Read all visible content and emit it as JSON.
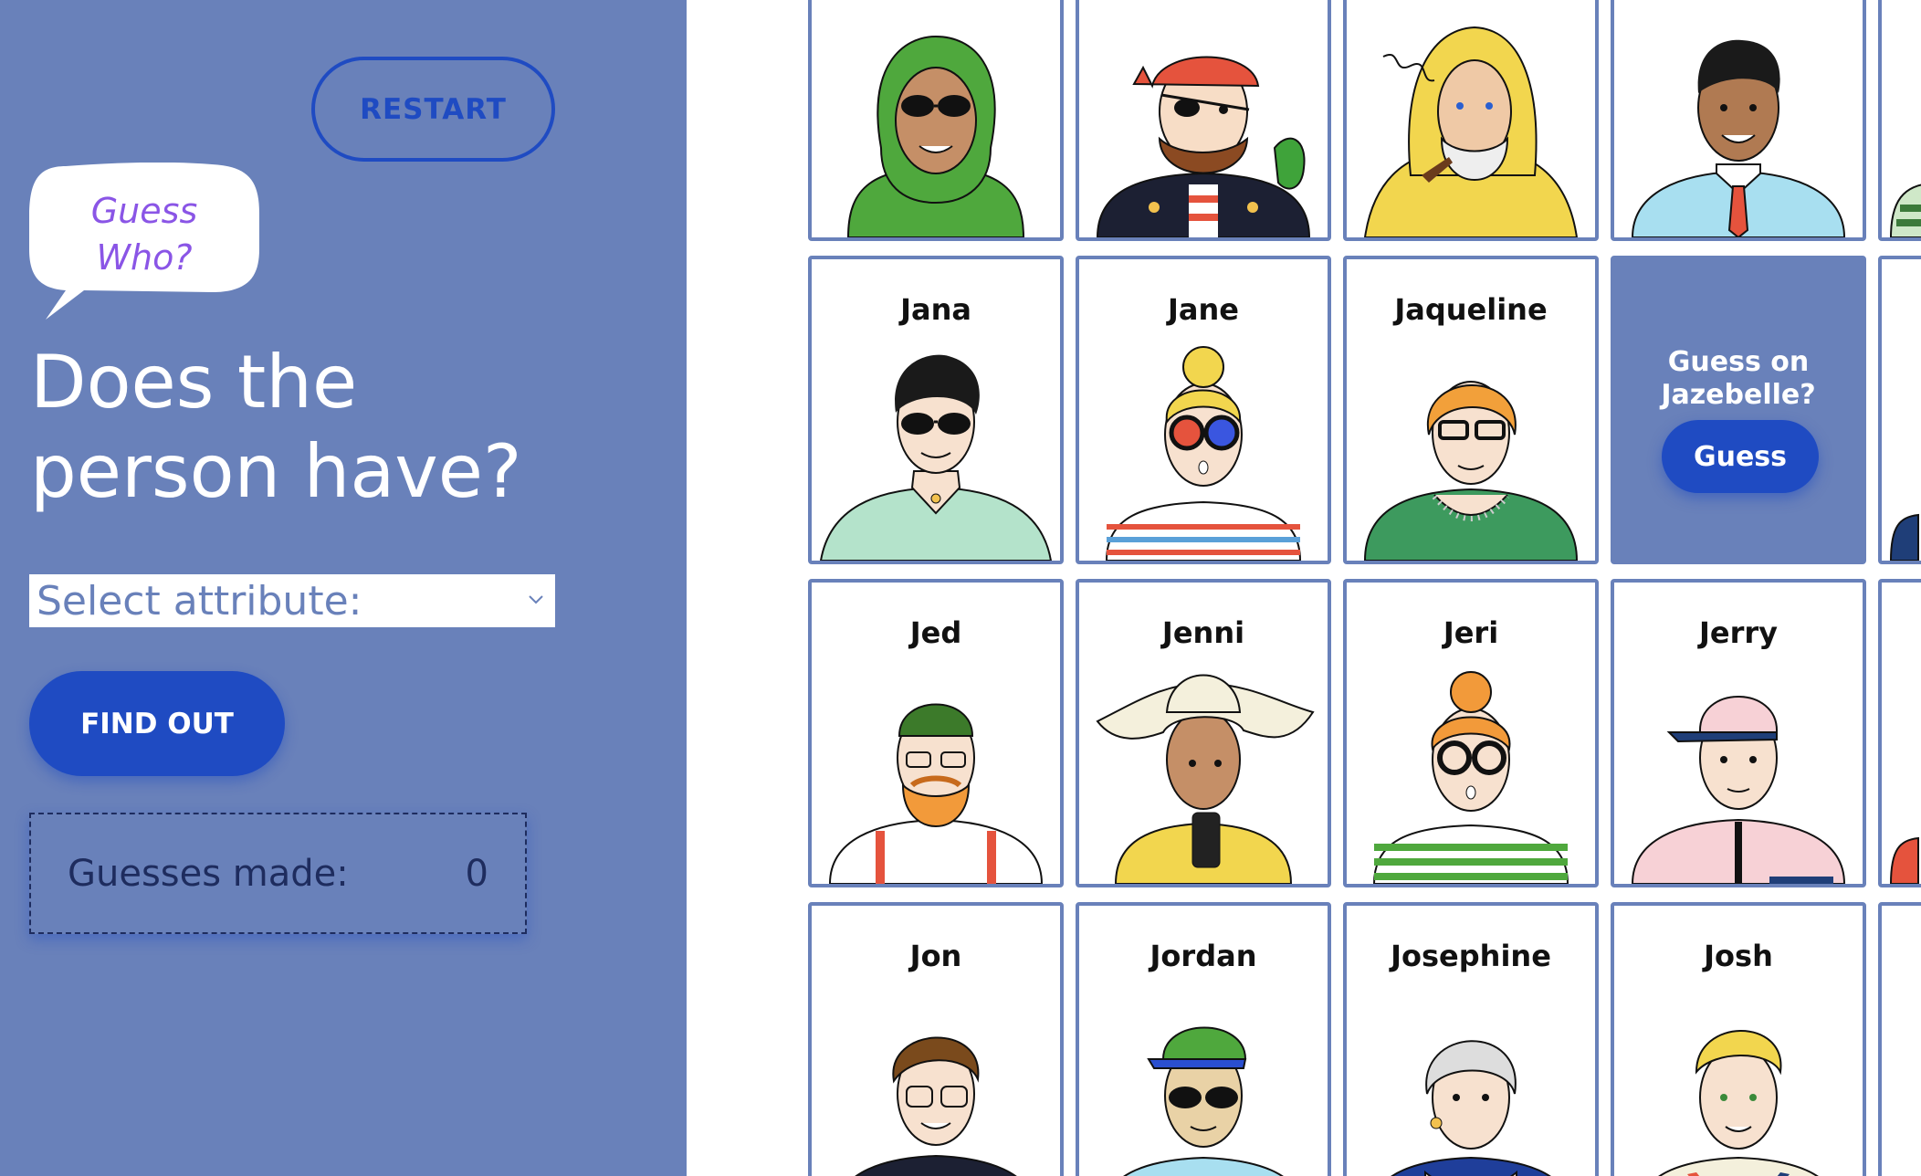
{
  "sidebar": {
    "restart_label": "RESTART",
    "logo_line1": "Guess",
    "logo_line2": "Who?",
    "question_line1": "Does the",
    "question_line2": "person have?",
    "select_placeholder": "Select attribute:",
    "find_out_label": "FIND OUT",
    "guesses_label": "Guesses made:",
    "guesses_count": "0"
  },
  "board": {
    "top_row": [
      {
        "name": "",
        "look": "hijab"
      },
      {
        "name": "",
        "look": "pirate"
      },
      {
        "name": "",
        "look": "fisherman"
      },
      {
        "name": "",
        "look": "preppy"
      }
    ],
    "row2": [
      {
        "name": "Jana",
        "look": "sunglasses"
      },
      {
        "name": "Jane",
        "look": "glasses-bun"
      },
      {
        "name": "Jaqueline",
        "look": "old-lady"
      }
    ],
    "selected_card": {
      "line1": "Guess on",
      "line2": "Jazebelle?",
      "button_label": "Guess"
    },
    "row3": [
      {
        "name": "Jed",
        "look": "beanie"
      },
      {
        "name": "Jenni",
        "look": "sunhat"
      },
      {
        "name": "Jeri",
        "look": "bun-glasses"
      },
      {
        "name": "Jerry",
        "look": "cap"
      }
    ],
    "row4": [
      {
        "name": "Jon",
        "look": "glasses"
      },
      {
        "name": "Jordan",
        "look": "cap-sunglasses"
      },
      {
        "name": "Josephine",
        "look": "grey-hair"
      },
      {
        "name": "Josh",
        "look": "blonde"
      }
    ]
  },
  "colors": {
    "sidebar_bg": "#6981ba",
    "accent": "#1f4bc2",
    "logo_text": "#8a55e6",
    "card_border": "#6981ba"
  }
}
